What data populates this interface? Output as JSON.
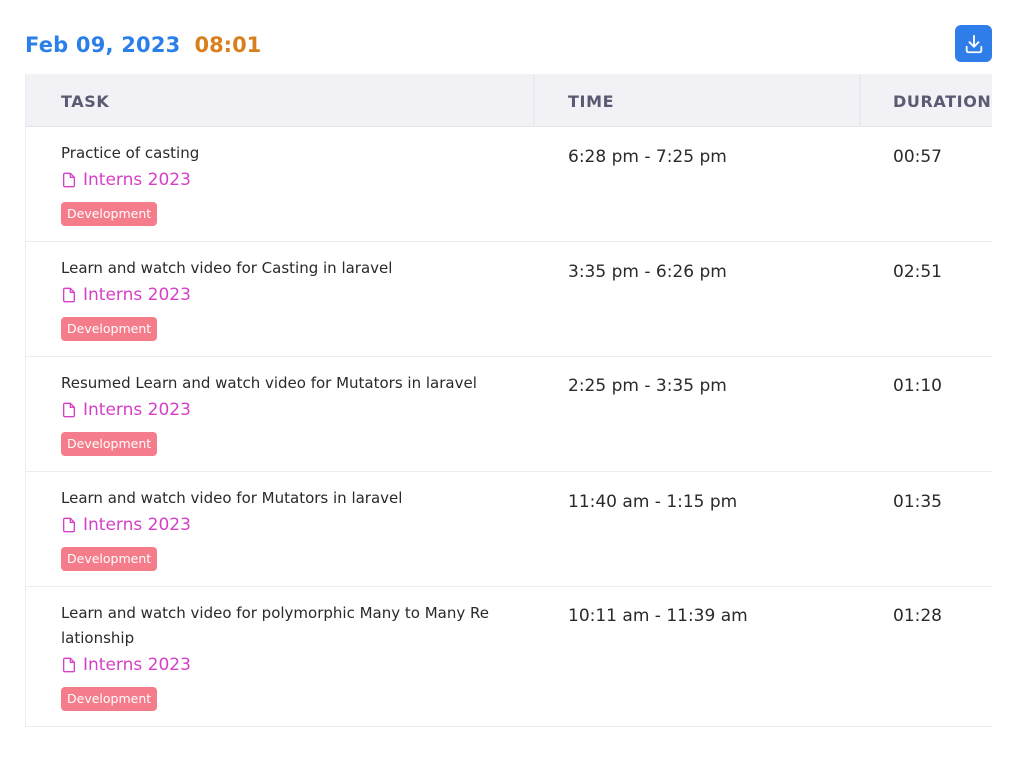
{
  "header": {
    "date": "Feb 09, 2023",
    "total_time": "08:01",
    "download_icon": "download-icon"
  },
  "table": {
    "columns": [
      "TASK",
      "TIME",
      "DURATION"
    ],
    "rows": [
      {
        "task": "Practice of casting",
        "project": "Interns 2023",
        "tag": "Development",
        "time": "6:28 pm - 7:25 pm",
        "duration": "00:57"
      },
      {
        "task": "Learn and watch video for Casting in laravel",
        "project": "Interns 2023",
        "tag": "Development",
        "time": "3:35 pm - 6:26 pm",
        "duration": "02:51"
      },
      {
        "task": "Resumed Learn and watch video for Mutators in laravel",
        "project": "Interns 2023",
        "tag": "Development",
        "time": "2:25 pm - 3:35 pm",
        "duration": "01:10"
      },
      {
        "task": "Learn and watch video for Mutators in laravel",
        "project": "Interns 2023",
        "tag": "Development",
        "time": "11:40 am - 1:15 pm",
        "duration": "01:35"
      },
      {
        "task": "Learn and watch video for polymorphic Many to Many Re\nlationship",
        "project": "Interns 2023",
        "tag": "Development",
        "time": "10:11 am - 11:39 am",
        "duration": "01:28"
      }
    ]
  },
  "colors": {
    "date": "#2b7fe8",
    "total_time": "#d9801e",
    "project": "#d63fc7",
    "tag": "#f57c8a",
    "button": "#2f7de9"
  }
}
